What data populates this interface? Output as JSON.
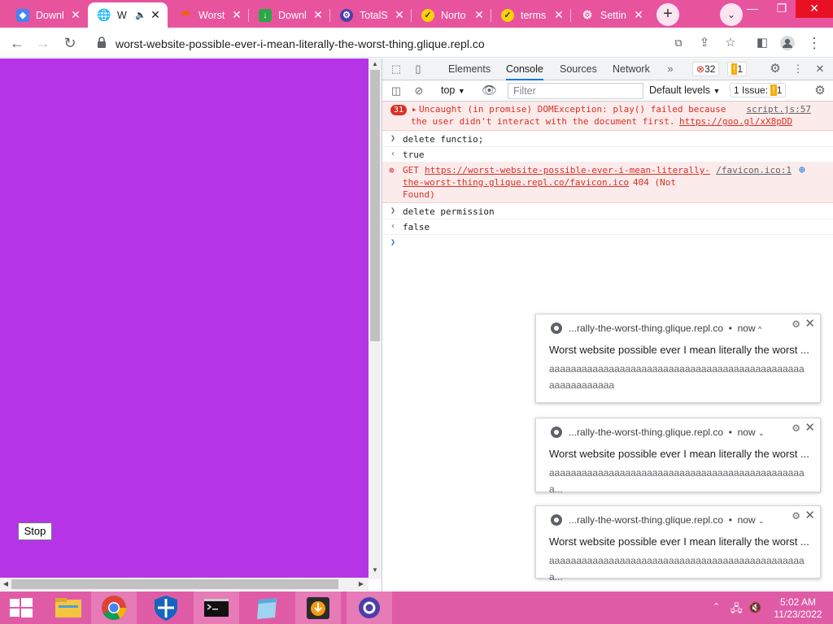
{
  "browser": {
    "tabs": [
      {
        "title": "Downl",
        "icon": "document-icon",
        "color": "#4285f4",
        "active": false
      },
      {
        "title": "W",
        "icon": "globe-icon",
        "color": "#5f6368",
        "active": true,
        "audio": true
      },
      {
        "title": "Worst",
        "icon": "repl-icon",
        "color": "#f26207",
        "active": false
      },
      {
        "title": "Downl",
        "icon": "download-icon",
        "color": "#2aa744",
        "active": false
      },
      {
        "title": "TotalS",
        "icon": "totalsecurity-icon",
        "color": "#4b3fa8",
        "active": false
      },
      {
        "title": "Norto",
        "icon": "norton-check-icon",
        "color": "#ffd200",
        "active": false
      },
      {
        "title": "terms",
        "icon": "norton-check-icon",
        "color": "#ffd200",
        "active": false
      },
      {
        "title": "Settin",
        "icon": "gear-icon",
        "color": "#5f6368",
        "active": false
      }
    ],
    "url": "worst-website-possible-ever-i-mean-literally-the-worst-thing.glique.repl.co"
  },
  "page": {
    "background": "#b535e6",
    "stop_label": "Stop"
  },
  "devtools": {
    "tabs": [
      "Elements",
      "Console",
      "Sources",
      "Network"
    ],
    "selected_tab": "Console",
    "error_count": "32",
    "warning_count": "1",
    "context": "top",
    "filter_placeholder": "Filter",
    "levels": "Default levels",
    "issues_label": "1 Issue:",
    "issues_count": "1",
    "console": {
      "entry1_count": "31",
      "entry1_line1": "Uncaught (in promise) DOMException: play() failed because",
      "entry1_line2": "the user didn't interact with the document first.",
      "entry1_link": "https://goo.gl/xX8pDD",
      "entry1_src": "script.js:57",
      "input1": "delete functio;",
      "output1": "true",
      "entry2_get": "GET",
      "entry2_url1": "https://worst-website-possible-ever-i-mean-literally-",
      "entry2_url2": "the-worst-thing.glique.repl.co/favicon.ico",
      "entry2_status1": "404 (Not",
      "entry2_status2": "Found)",
      "entry2_src": "/favicon.ico:1",
      "input2": "delete permission",
      "output2": "false"
    }
  },
  "notifications": [
    {
      "origin": "...rally-the-worst-thing.glique.repl.co",
      "time": "now",
      "title": "Worst website possible ever I mean literally the worst ...",
      "body": "aaaaaaaaaaaaaaaaaaaaaaaaaaaaaaaaaaaaaaaaaaaaaaaaaaaaaaaaaaa"
    },
    {
      "origin": "...rally-the-worst-thing.glique.repl.co",
      "time": "now",
      "title": "Worst website possible ever I mean literally the worst ...",
      "body": "aaaaaaaaaaaaaaaaaaaaaaaaaaaaaaaaaaaaaaaaaaaaaaaa..."
    },
    {
      "origin": "...rally-the-worst-thing.glique.repl.co",
      "time": "now",
      "title": "Worst website possible ever I mean literally the worst ...",
      "body": "aaaaaaaaaaaaaaaaaaaaaaaaaaaaaaaaaaaaaaaaaaaaaaaa..."
    }
  ],
  "taskbar": {
    "apps": [
      "start-icon",
      "file-explorer-icon",
      "chrome-icon",
      "defender-icon",
      "cmd-icon",
      "notepad-icon",
      "installer-icon",
      "totalsecurity-icon"
    ],
    "time": "5:02 AM",
    "date": "11/23/2022"
  }
}
